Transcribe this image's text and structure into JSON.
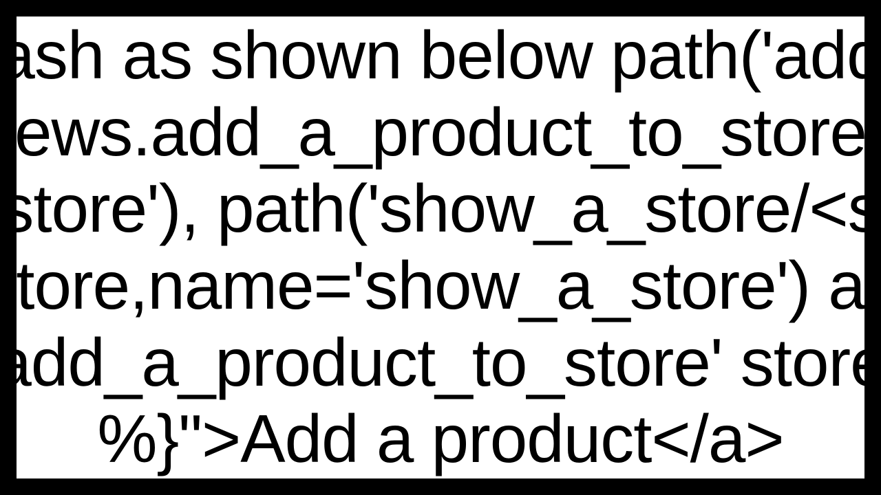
{
  "lines": {
    "l1": "ash as shown below path('add",
    "l2": "ews.add_a_product_to_store",
    "l3": "store'), path('show_a_store/<s",
    "l4": "tore,name='show_a_store')  a",
    "l5": "add_a_product_to_store' store",
    "l6": "%}\">Add a product</a>"
  }
}
